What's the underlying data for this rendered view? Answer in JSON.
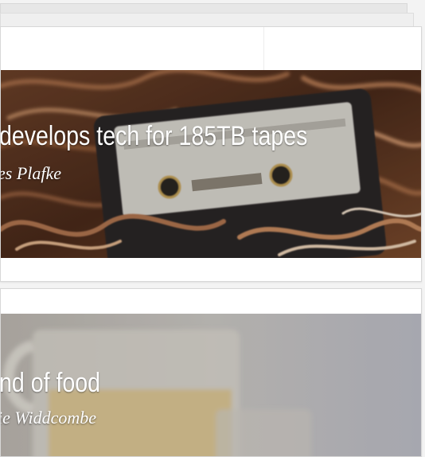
{
  "articles": [
    {
      "headline": "develops tech for 185TB tapes",
      "author": "es Plafke",
      "image": "cassette-tape-ribbon"
    },
    {
      "headline": "nd of food",
      "author": "ie Widdcombe",
      "image": "blender-jug-soft-focus"
    }
  ]
}
